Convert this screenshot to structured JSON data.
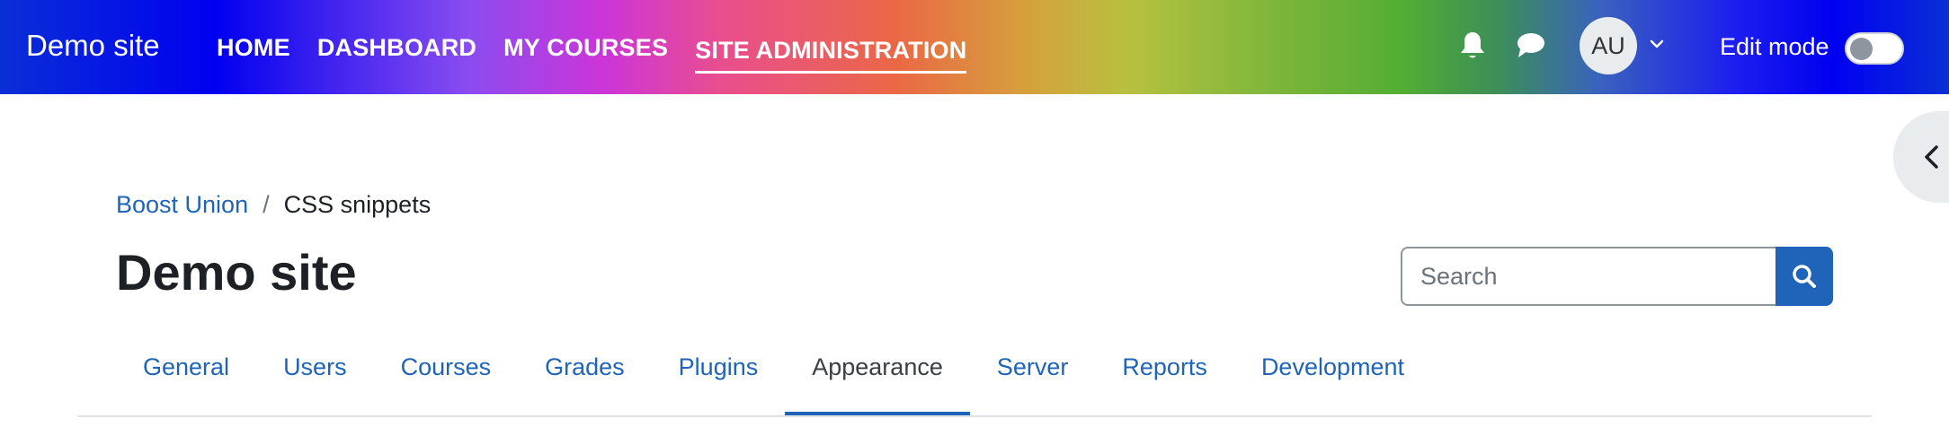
{
  "navbar": {
    "brand": "Demo site",
    "links": [
      {
        "label": "HOME"
      },
      {
        "label": "DASHBOARD"
      },
      {
        "label": "MY COURSES"
      },
      {
        "label": "SITE ADMINISTRATION",
        "active": true
      }
    ],
    "notifications_icon": "bell-icon",
    "messages_icon": "chat-icon",
    "avatar_initials": "AU",
    "edit_mode_label": "Edit mode",
    "edit_mode_on": false
  },
  "breadcrumb": {
    "parent": "Boost Union",
    "separator": "/",
    "current": "CSS snippets"
  },
  "page": {
    "title": "Demo site"
  },
  "search": {
    "placeholder": "Search",
    "value": ""
  },
  "tabs": [
    {
      "label": "General"
    },
    {
      "label": "Users"
    },
    {
      "label": "Courses"
    },
    {
      "label": "Grades"
    },
    {
      "label": "Plugins"
    },
    {
      "label": "Appearance",
      "active": true
    },
    {
      "label": "Server"
    },
    {
      "label": "Reports"
    },
    {
      "label": "Development"
    }
  ],
  "colors": {
    "link": "#1f64b8",
    "text": "#1d2125",
    "primary": "#1f64b8"
  }
}
